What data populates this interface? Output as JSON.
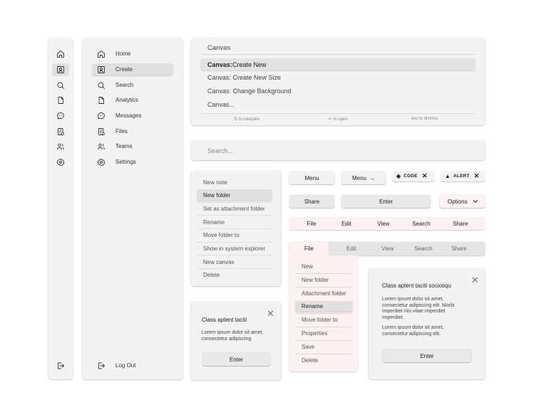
{
  "rail": {
    "items": [
      {
        "icon": "home-icon",
        "active": false
      },
      {
        "icon": "user-square-icon",
        "active": true
      },
      {
        "icon": "search-icon",
        "active": false
      },
      {
        "icon": "file-icon",
        "active": false
      },
      {
        "icon": "message-icon",
        "active": false
      },
      {
        "icon": "files-icon",
        "active": false
      },
      {
        "icon": "users-icon",
        "active": false
      },
      {
        "icon": "gear-icon",
        "active": false
      }
    ],
    "logout_icon": "logout-icon"
  },
  "sidebar": {
    "items": [
      {
        "label": "Home",
        "icon": "home-icon"
      },
      {
        "label": "Create",
        "icon": "user-square-icon"
      },
      {
        "label": "Search",
        "icon": "search-icon"
      },
      {
        "label": "Analytics",
        "icon": "file-icon"
      },
      {
        "label": "Messages",
        "icon": "message-icon"
      },
      {
        "label": "Files",
        "icon": "files-icon"
      },
      {
        "label": "Teams",
        "icon": "users-icon"
      },
      {
        "label": "Settings",
        "icon": "gear-icon"
      }
    ],
    "logout_label": "Log Out"
  },
  "palette": {
    "query": "Canvas",
    "results": [
      {
        "bold": "Canvas:",
        "rest": " Create New"
      },
      {
        "bold": "",
        "rest": "Canvas: Create New Size"
      },
      {
        "bold": "",
        "rest": "Canvas: Change Background"
      },
      {
        "bold": "",
        "rest": "Canvas..."
      }
    ],
    "hints": {
      "navigate": "⇅ to navigate",
      "open": "↵ to open",
      "dismiss": "esc to dismiss"
    }
  },
  "search": {
    "placeholder": "Search..."
  },
  "context_menu": {
    "items": [
      "New note",
      "New folder",
      "Set as attachment folder",
      "Rename",
      "Move folder to",
      "Show in system explorer",
      "New canvas",
      "Delete"
    ]
  },
  "buttons": {
    "menu": "Menu",
    "menu_arrow": "Menu",
    "arrow_glyph": "→",
    "share": "Share",
    "enter": "Enter",
    "options": "Options"
  },
  "tags": {
    "code": "CODE",
    "alert": "ALERT",
    "close_glyph": "✕"
  },
  "menubar1": {
    "items": [
      "File",
      "Edit",
      "View",
      "Search",
      "Share"
    ]
  },
  "menubar2": {
    "items": [
      "File",
      "Edit",
      "View",
      "Search",
      "Share"
    ]
  },
  "dropdown": {
    "items": [
      "New",
      "New folder",
      "Attachment folder",
      "Rename",
      "Move folder to",
      "Properties",
      "Save",
      "Delete"
    ]
  },
  "dialog1": {
    "title": "Class aptent taciti",
    "body": "Lorem ipsum dolor sit amet, consectetur adipiscing.",
    "button": "Enter",
    "close": "✕"
  },
  "dialog2": {
    "title": "Class aptent taciti sociosqu",
    "body1": "Lorem ipsum dolor sit amet, consectetur adipiscing elit. Morbi imperdiet nisi vitae imperdiet imperdiet.",
    "body2": "Lorem ipsum dolor sit amet, consectetur adipiscing elit.",
    "button": "Enter",
    "close": "✕"
  },
  "colors": {
    "panel": "#f3f3f3",
    "active": "#e0e0e0",
    "pink": "#fdf1f1",
    "text": "#333333"
  }
}
